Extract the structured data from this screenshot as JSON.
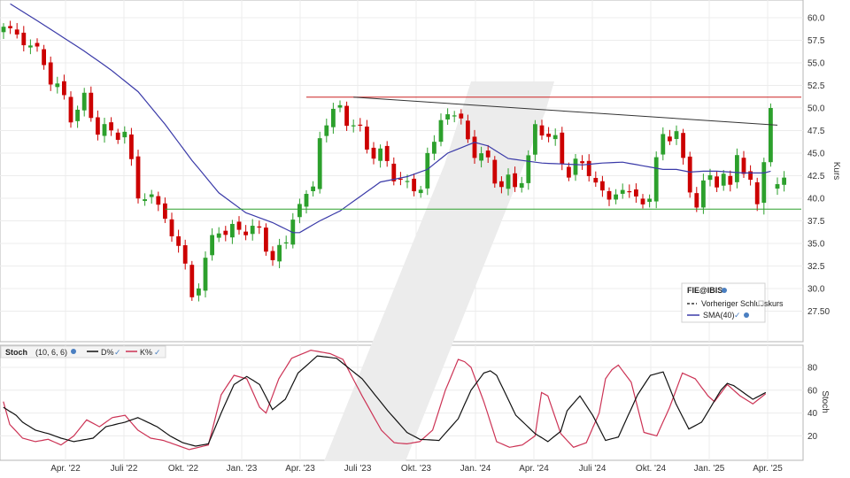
{
  "chart_data": [
    {
      "type": "candlestick",
      "ylabel": "Kurs",
      "ylim": [
        25,
        61.25
      ],
      "y_ticks": [
        "60.0",
        "57.5",
        "55.0",
        "52.5",
        "50.0",
        "47.5",
        "45.0",
        "42.5",
        "40.0",
        "37.5",
        "35.0",
        "32.5",
        "30.0",
        "27.50"
      ],
      "x_ticks": [
        "Apr. '22",
        "Juli '22",
        "Okt. '22",
        "Jan. '23",
        "Apr. '23",
        "Juli '23",
        "Okt. '23",
        "Jan. '24",
        "Apr. '24",
        "Juli '24",
        "Okt. '24",
        "Jan. '25",
        "Apr. '25"
      ],
      "up_color": "#2ca02c",
      "down_color": "#cc0000",
      "sma_color": "#3a3aa8",
      "close_anchors": [
        [
          0,
          59
        ],
        [
          2,
          58
        ],
        [
          4,
          57
        ],
        [
          6,
          55
        ],
        [
          8,
          52
        ],
        [
          10,
          49.5
        ],
        [
          12,
          50.5
        ],
        [
          14,
          48
        ],
        [
          16,
          47
        ],
        [
          18,
          47.5
        ],
        [
          20,
          40
        ],
        [
          22,
          40.5
        ],
        [
          24,
          37.5
        ],
        [
          26,
          35
        ],
        [
          28,
          29
        ],
        [
          29,
          31
        ],
        [
          30,
          33
        ],
        [
          32,
          37
        ],
        [
          34,
          36
        ],
        [
          36,
          37
        ],
        [
          38,
          36
        ],
        [
          40,
          33.5
        ],
        [
          42,
          35
        ],
        [
          43,
          38
        ],
        [
          44,
          39.5
        ],
        [
          46,
          41
        ],
        [
          47,
          47
        ],
        [
          48,
          48.5
        ],
        [
          50,
          50
        ],
        [
          52,
          48
        ],
        [
          54,
          46
        ],
        [
          56,
          44.5
        ],
        [
          58,
          43
        ],
        [
          60,
          41
        ],
        [
          62,
          41.5
        ],
        [
          63,
          44.5
        ],
        [
          64,
          46
        ],
        [
          65,
          49
        ],
        [
          66,
          49.5
        ],
        [
          68,
          48.5
        ],
        [
          70,
          45
        ],
        [
          72,
          44
        ],
        [
          73,
          42.5
        ],
        [
          74,
          41.5
        ],
        [
          76,
          41.5
        ],
        [
          78,
          44
        ],
        [
          79,
          47.5
        ],
        [
          80,
          48
        ],
        [
          82,
          46
        ],
        [
          83,
          44
        ],
        [
          84,
          43
        ],
        [
          85,
          44
        ],
        [
          86,
          43.5
        ],
        [
          88,
          42
        ],
        [
          90,
          39.5
        ],
        [
          91,
          40.5
        ],
        [
          92,
          41.5
        ],
        [
          94,
          39.5
        ],
        [
          96,
          40.5
        ],
        [
          97,
          43.5
        ],
        [
          98,
          47
        ],
        [
          99,
          47.5
        ],
        [
          100,
          47
        ],
        [
          101,
          43.5
        ],
        [
          102,
          41.5
        ],
        [
          103,
          39.5
        ],
        [
          104,
          41
        ],
        [
          105,
          42.5
        ],
        [
          106,
          42
        ],
        [
          107,
          42.5
        ],
        [
          108,
          41
        ],
        [
          109,
          45
        ],
        [
          110,
          43
        ],
        [
          111,
          42
        ],
        [
          112,
          39
        ],
        [
          113,
          44
        ],
        [
          114,
          41.5
        ]
      ],
      "special": [
        [
          113,
          39.5,
          44,
          38.2,
          44.5
        ],
        [
          114,
          44,
          50,
          43.5,
          50.5
        ]
      ],
      "sma_anchors": [
        [
          0,
          62
        ],
        [
          6,
          59.2
        ],
        [
          12,
          56.3
        ],
        [
          16,
          54.2
        ],
        [
          20,
          51.8
        ],
        [
          24,
          48.2
        ],
        [
          28,
          44.2
        ],
        [
          32,
          40.6
        ],
        [
          36,
          38.4
        ],
        [
          40,
          37.3
        ],
        [
          43,
          36.2
        ],
        [
          44,
          36.2
        ],
        [
          47,
          37.5
        ],
        [
          50,
          38.6
        ],
        [
          53,
          40.2
        ],
        [
          56,
          41.8
        ],
        [
          60,
          42.4
        ],
        [
          63,
          43.2
        ],
        [
          66,
          45
        ],
        [
          70,
          46.2
        ],
        [
          72,
          45.8
        ],
        [
          75,
          44.4
        ],
        [
          80,
          43.9
        ],
        [
          86,
          43.7
        ],
        [
          89,
          43.9
        ],
        [
          92,
          44
        ],
        [
          95,
          43.6
        ],
        [
          98,
          43.2
        ],
        [
          100,
          43.2
        ],
        [
          102,
          42.9
        ],
        [
          104,
          43
        ],
        [
          106,
          43
        ],
        [
          108,
          42.9
        ],
        [
          110,
          42.8
        ],
        [
          113,
          42.8
        ],
        [
          114,
          43
        ]
      ],
      "resistance_level": 51.2,
      "support_level": 38.8,
      "trendline": [
        [
          52,
          51.2
        ],
        [
          115,
          48.1
        ]
      ],
      "legend": {
        "title": "FIE@IBIS",
        "items": [
          "Vorheriger Schlusskurs",
          "SMA(40)"
        ]
      }
    },
    {
      "type": "line",
      "title": "Stoch",
      "params": "(10, 6, 6)",
      "ylabel": "Stoch",
      "ylim": [
        0,
        100
      ],
      "y_ticks": [
        "80",
        "60",
        "40",
        "20"
      ],
      "series": [
        {
          "name": "D%",
          "color": "#111111",
          "values": [
            [
              0,
              45
            ],
            [
              2,
              38
            ],
            [
              3,
              32
            ],
            [
              5,
              25
            ],
            [
              7,
              22
            ],
            [
              9,
              18
            ],
            [
              11,
              15
            ],
            [
              14,
              18
            ],
            [
              16,
              28
            ],
            [
              19,
              32
            ],
            [
              21,
              36
            ],
            [
              24,
              28
            ],
            [
              26,
              20
            ],
            [
              28,
              14
            ],
            [
              30,
              11
            ],
            [
              32,
              13
            ],
            [
              34,
              40
            ],
            [
              36,
              65
            ],
            [
              38,
              72
            ],
            [
              40,
              65
            ],
            [
              42,
              43
            ],
            [
              44,
              52
            ],
            [
              46,
              75
            ],
            [
              49,
              90
            ],
            [
              52,
              88
            ],
            [
              56,
              70
            ],
            [
              60,
              42
            ],
            [
              63,
              23
            ],
            [
              65,
              17
            ],
            [
              68,
              16
            ],
            [
              71,
              35
            ],
            [
              73,
              60
            ],
            [
              75,
              75
            ],
            [
              76,
              77
            ],
            [
              77,
              73
            ],
            [
              80,
              38
            ],
            [
              83,
              22
            ],
            [
              85,
              15
            ],
            [
              87,
              24
            ],
            [
              88,
              42
            ],
            [
              90,
              55
            ],
            [
              92,
              38
            ],
            [
              94,
              16
            ],
            [
              96,
              19
            ],
            [
              99,
              56
            ],
            [
              101,
              73
            ],
            [
              103,
              76
            ],
            [
              105,
              48
            ],
            [
              107,
              26
            ],
            [
              109,
              32
            ],
            [
              112,
              60
            ],
            [
              113,
              66
            ],
            [
              114,
              64
            ],
            [
              117,
              52
            ],
            [
              119,
              58
            ]
          ]
        },
        {
          "name": "K%",
          "color": "#cc3355",
          "values": [
            [
              0,
              50
            ],
            [
              1,
              30
            ],
            [
              3,
              18
            ],
            [
              5,
              15
            ],
            [
              7,
              17
            ],
            [
              9,
              12
            ],
            [
              11,
              20
            ],
            [
              13,
              34
            ],
            [
              15,
              28
            ],
            [
              17,
              36
            ],
            [
              19,
              38
            ],
            [
              21,
              25
            ],
            [
              23,
              18
            ],
            [
              25,
              16
            ],
            [
              27,
              12
            ],
            [
              29,
              8
            ],
            [
              32,
              12
            ],
            [
              34,
              56
            ],
            [
              36,
              73
            ],
            [
              38,
              70
            ],
            [
              40,
              45
            ],
            [
              41,
              40
            ],
            [
              43,
              70
            ],
            [
              45,
              88
            ],
            [
              48,
              95
            ],
            [
              51,
              92
            ],
            [
              53,
              87
            ],
            [
              56,
              55
            ],
            [
              59,
              25
            ],
            [
              61,
              14
            ],
            [
              63,
              13
            ],
            [
              65,
              15
            ],
            [
              67,
              25
            ],
            [
              69,
              60
            ],
            [
              71,
              87
            ],
            [
              72,
              85
            ],
            [
              73,
              80
            ],
            [
              75,
              50
            ],
            [
              77,
              15
            ],
            [
              79,
              10
            ],
            [
              81,
              12
            ],
            [
              83,
              20
            ],
            [
              84,
              58
            ],
            [
              85,
              55
            ],
            [
              87,
              22
            ],
            [
              89,
              10
            ],
            [
              91,
              14
            ],
            [
              93,
              40
            ],
            [
              94,
              70
            ],
            [
              95,
              78
            ],
            [
              96,
              82
            ],
            [
              98,
              67
            ],
            [
              100,
              23
            ],
            [
              102,
              20
            ],
            [
              104,
              45
            ],
            [
              106,
              75
            ],
            [
              108,
              70
            ],
            [
              110,
              55
            ],
            [
              111,
              50
            ],
            [
              113,
              65
            ],
            [
              115,
              55
            ],
            [
              117,
              48
            ],
            [
              119,
              57
            ]
          ]
        }
      ]
    }
  ]
}
